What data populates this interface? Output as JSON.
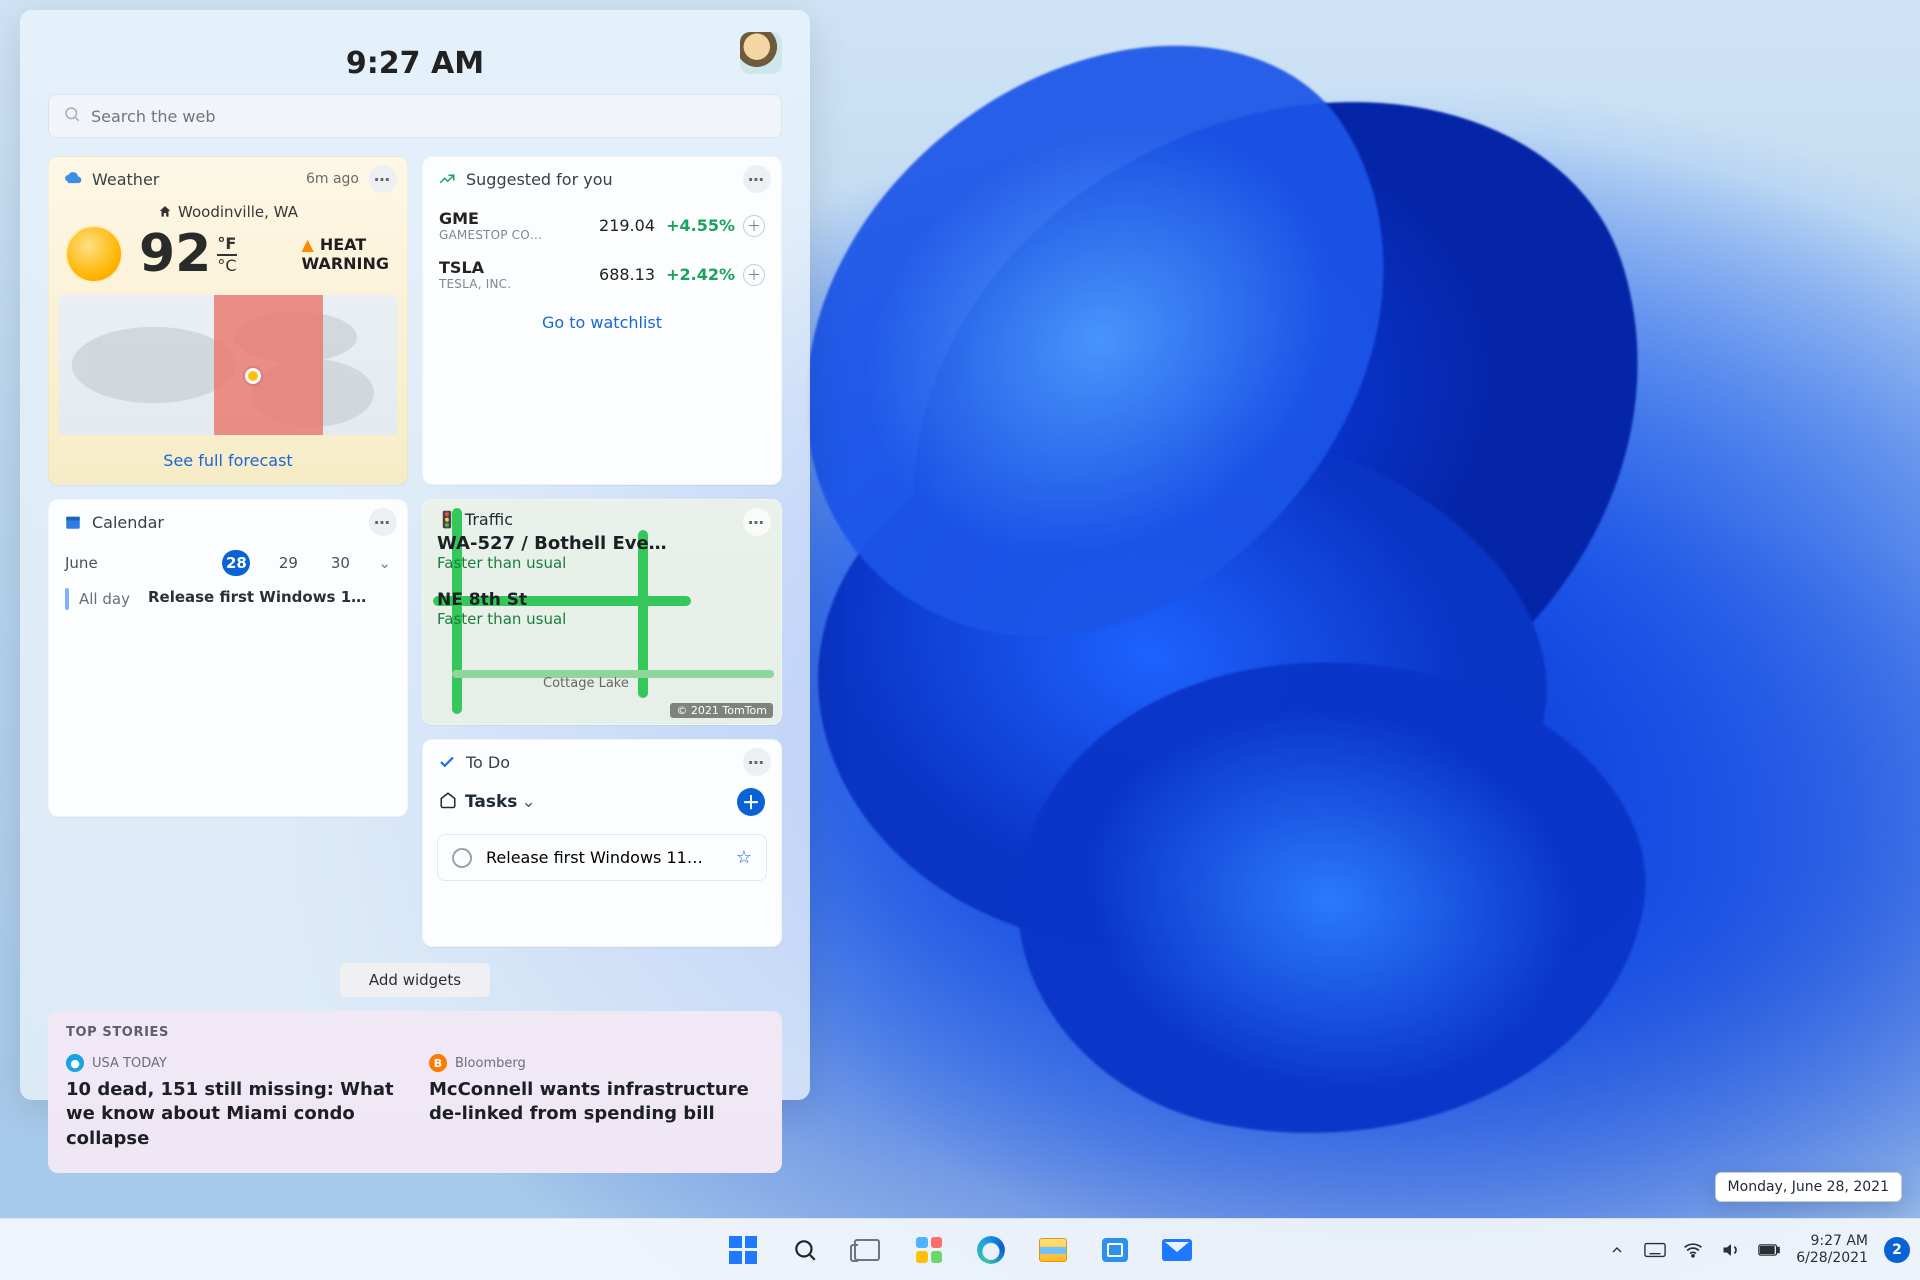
{
  "panel": {
    "time": "9:27 AM",
    "search_placeholder": "Search the web",
    "add_widgets": "Add widgets"
  },
  "weather": {
    "title": "Weather",
    "age": "6m ago",
    "location": "Woodinville, WA",
    "temp": "92",
    "unit_f": "°F",
    "unit_c": "°C",
    "warn1": "HEAT",
    "warn2": "WARNING",
    "link": "See full forecast"
  },
  "stocks": {
    "title": "Suggested for you",
    "rows": [
      {
        "sym": "GME",
        "name": "GAMESTOP CO…",
        "price": "219.04",
        "chg": "+4.55%"
      },
      {
        "sym": "TSLA",
        "name": "TESLA, INC.",
        "price": "688.13",
        "chg": "+2.42%"
      }
    ],
    "link": "Go to watchlist"
  },
  "calendar": {
    "title": "Calendar",
    "month": "June",
    "days": [
      "28",
      "29",
      "30"
    ],
    "selected": "28",
    "allday": "All day",
    "event": "Release first Windows 1…"
  },
  "traffic": {
    "title": "Traffic",
    "route1": "WA-527 / Bothell Eve…",
    "status1": "Faster than usual",
    "route2": "NE 8th St",
    "status2": "Faster than usual",
    "lake": "Cottage Lake",
    "copy": "© 2021 TomTom"
  },
  "todo": {
    "title": "To Do",
    "list": "Tasks",
    "item": "Release first Windows 11…"
  },
  "stories": {
    "header": "TOP STORIES",
    "items": [
      {
        "pub": "USA TODAY",
        "pub_ico": "u",
        "headline": "10 dead, 151 still missing: What we know about Miami condo collapse"
      },
      {
        "pub": "Bloomberg",
        "pub_ico": "B",
        "headline": "McConnell wants infrastructure de-linked from spending bill"
      }
    ]
  },
  "tooltip": {
    "date_long": "Monday, June 28, 2021"
  },
  "tray": {
    "time": "9:27 AM",
    "date": "6/28/2021",
    "badge": "2"
  }
}
